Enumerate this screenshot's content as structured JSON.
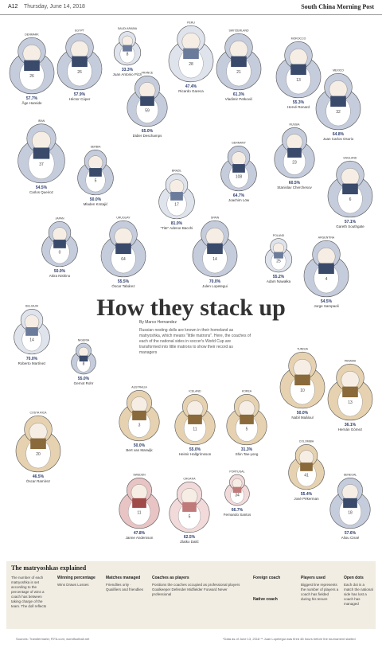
{
  "header": {
    "page": "A12",
    "date": "Thursday, June 14, 2018",
    "brand": "South China Morning Post"
  },
  "title": "How they stack up",
  "byline": "By Marco Hernandez",
  "intro": "Russian nesting dolls are known in their homeland as matryoshka, which means \"little matrons\". Here, the coaches of each of the national sides in soccer's World Cup are transformed into little matrons to show their record as managers",
  "teams": [
    {
      "team": "DENMARK",
      "coach": "Åge Hareide",
      "pct": "57.7%",
      "rec": "26"
    },
    {
      "team": "EGYPT",
      "coach": "Héctor Cúper",
      "pct": "57.9%",
      "rec": "26"
    },
    {
      "team": "SAUDI ARABIA",
      "coach": "Juan Antonio Pizzi",
      "pct": "33.3%",
      "rec": "8"
    },
    {
      "team": "PERU",
      "coach": "Ricardo Gareca",
      "pct": "47.4%",
      "rec": "28"
    },
    {
      "team": "SWITZERLAND",
      "coach": "Vladimir Petković",
      "pct": "61.3%",
      "rec": "21"
    },
    {
      "team": "MOROCCO",
      "coach": "Hervé Renard",
      "pct": "55.3%",
      "rec": "13"
    },
    {
      "team": "MEXICO",
      "coach": "Juan Carlos Osorio",
      "pct": "64.8%",
      "rec": "32"
    },
    {
      "team": "FRANCE",
      "coach": "Didier Deschamps",
      "pct": "65.0%",
      "rec": "59"
    },
    {
      "team": "RUSSIA",
      "coach": "Stanislav Cherchesov",
      "pct": "60.5%",
      "rec": "23"
    },
    {
      "team": "IRAN",
      "coach": "Carlos Queiroz",
      "pct": "54.5%",
      "rec": "37"
    },
    {
      "team": "SERBIA",
      "coach": "Mladen Krstajić",
      "pct": "50.0%",
      "rec": "5"
    },
    {
      "team": "ENGLAND",
      "coach": "Gareth Southgate",
      "pct": "57.1%",
      "rec": "6"
    },
    {
      "team": "GERMANY",
      "coach": "Joachim Löw",
      "pct": "64.7%",
      "rec": "108"
    },
    {
      "team": "BRAZIL",
      "coach": "\"Tite\" Adenor Bacchi",
      "pct": "81.0%",
      "rec": "17"
    },
    {
      "team": "SPAIN",
      "coach": "Julen Lopetegui",
      "pct": "70.0%",
      "rec": "14"
    },
    {
      "team": "ARGENTINA",
      "coach": "Jorge Sampaoli",
      "pct": "54.5%",
      "rec": "4"
    },
    {
      "team": "URUGUAY",
      "coach": "Óscar Tabárez",
      "pct": "55.5%",
      "rec": "64"
    },
    {
      "team": "POLAND",
      "coach": "Adam Nawałka",
      "pct": "55.2%",
      "rec": "25"
    },
    {
      "team": "JAPAN",
      "coach": "Akira Nishino",
      "pct": "50.0%",
      "rec": "0"
    },
    {
      "team": "BELGIUM",
      "coach": "Roberto Martínez",
      "pct": "70.0%",
      "rec": "14"
    },
    {
      "team": "NIGERIA",
      "coach": "Gernot Rohr",
      "pct": "55.0%",
      "rec": "8"
    },
    {
      "team": "TUNISIA",
      "coach": "Nabil Maâloul",
      "pct": "50.0%",
      "rec": "10"
    },
    {
      "team": "PANAMA",
      "coach": "Hernán Gómez",
      "pct": "36.1%",
      "rec": "13"
    },
    {
      "team": "AUSTRALIA",
      "coach": "Bert van Marwijk",
      "pct": "50.0%",
      "rec": "3"
    },
    {
      "team": "ICELAND",
      "coach": "Heimir Hallgrímsson",
      "pct": "55.0%",
      "rec": "11"
    },
    {
      "team": "KOREA",
      "coach": "Shin Tae-yong",
      "pct": "31.3%",
      "rec": "5"
    },
    {
      "team": "COSTA RICA",
      "coach": "Óscar Ramírez",
      "pct": "46.5%",
      "rec": "20"
    },
    {
      "team": "COLOMBIA",
      "coach": "José Pékerman",
      "pct": "55.4%",
      "rec": "41"
    },
    {
      "team": "SWEDEN",
      "coach": "Janne Andersson",
      "pct": "47.8%",
      "rec": "11"
    },
    {
      "team": "CROATIA",
      "coach": "Zlatko Dalić",
      "pct": "62.5%",
      "rec": "5"
    },
    {
      "team": "PORTUGAL",
      "coach": "Fernando Santos",
      "pct": "66.7%",
      "rec": "34"
    },
    {
      "team": "SENEGAL",
      "coach": "Aliou Cissé",
      "pct": "57.6%",
      "rec": "18"
    }
  ],
  "legend": {
    "title": "The matryoshkas explained",
    "c1": "The number of each matryoshka is set according to the percentage of wins a coach has between taking charge of the team. The doll reflects",
    "c2_title": "Winning percentage",
    "c2": "Wins  Draws  Losses",
    "c3_title": "Matches managed",
    "c3": "Friendlies only · Qualifiers and friendlies",
    "c4_title": "Coaches as players",
    "c4": "Positions the coaches occupied as professional players",
    "c4_items": "Goalkeeper  Defender  Midfielder  Forward  Never professional",
    "c5_title": "Foreign coach",
    "c5b": "Native coach",
    "c6_title": "Players used",
    "c6": "Biggest line represents the number of players a coach has fielded during his tenure",
    "c7_title": "Open dots",
    "c7": "Each dot is a match the national side has lost a coach has managed"
  },
  "footer": "Sources: Transfermarkt; FIFA.com; worldfootball.net",
  "footer2": "*Data as of June 13, 2018   ** Juan Lopetegui was fired 48 hours before the tournament started",
  "colors": {
    "blue": "#3a4a6b",
    "lightblue": "#c5ccdc",
    "brown": "#8a6a3a",
    "tan": "#e6d2b0",
    "red": "#a04a4a",
    "pink": "#e8c4c4",
    "green": "#7aa0a0"
  }
}
